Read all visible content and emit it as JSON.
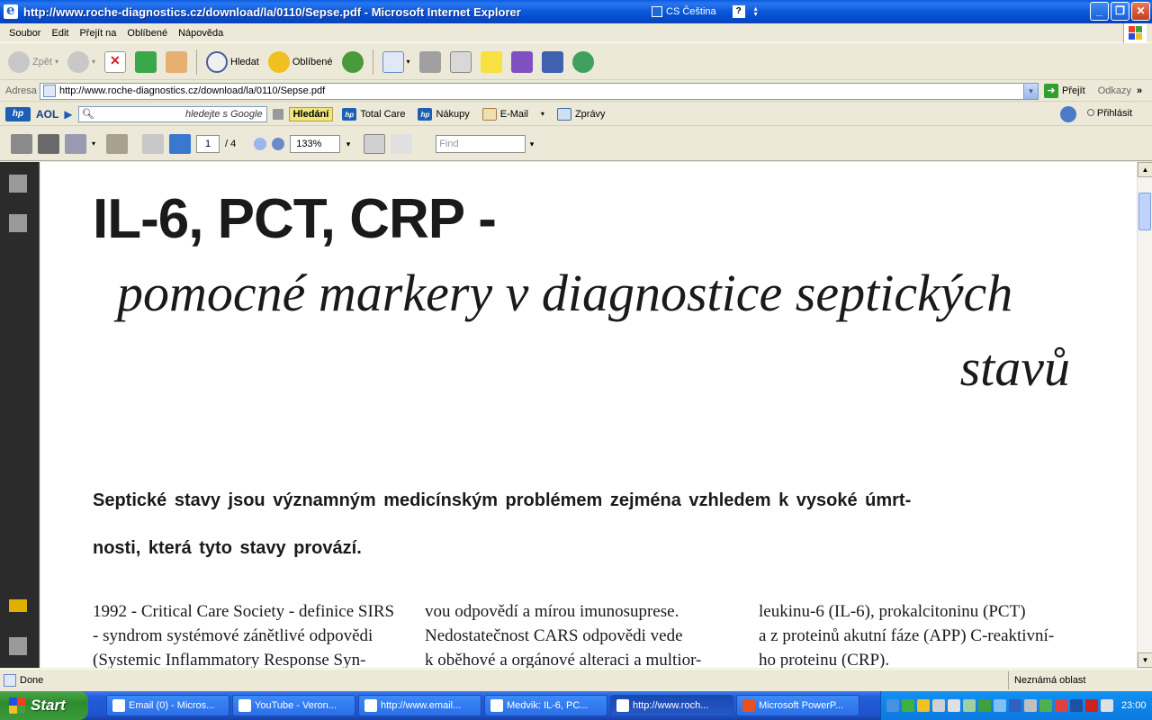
{
  "window": {
    "title": "http://www.roche-diagnostics.cz/download/la/0110/Sepse.pdf - Microsoft Internet Explorer",
    "language": "CS Čeština"
  },
  "menu": [
    "Soubor",
    "Edit",
    "Přejít na",
    "Oblíbené",
    "Nápověda"
  ],
  "toolbar": {
    "back_label": "Zpět",
    "search_label": "Hledat",
    "favorites_label": "Oblíbené"
  },
  "address": {
    "label": "Adresa",
    "url": "http://www.roche-diagnostics.cz/download/la/0110/Sepse.pdf",
    "go_label": "Přejít",
    "links_label": "Odkazy"
  },
  "hpbar": {
    "aol": "AOL",
    "search_hint": "hledejte s Google",
    "search_button": "Hledání",
    "total_care": "Total Care",
    "shopping": "Nákupy",
    "email": "E-Mail",
    "news": "Zprávy",
    "login": "Přihlásit"
  },
  "pdfbar": {
    "page": "1",
    "page_total": "/ 4",
    "zoom": "133%",
    "find_placeholder": "Find"
  },
  "document": {
    "title": "IL-6, PCT, CRP -",
    "subtitle_line1": "pomocné markery v diagnostice septických",
    "subtitle_line2": "stavů",
    "lead_line1": "Septické stavy jsou významným medicínským problémem zejména vzhledem k vysoké úmrt-",
    "lead_line2": "nosti, která tyto stavy provází.",
    "col1": [
      "1992 - Critical Care Society - definice SIRS",
      "- syndrom systémové zánětlivé odpovědi",
      "(Systemic Inflammatory Response Syn-"
    ],
    "col2": [
      "vou odpovědí a mírou imunosuprese.",
      "Nedostatečnost CARS odpovědi vede",
      "k oběhové a orgánové alteraci a multior-"
    ],
    "col3": [
      "leukinu-6 (IL-6), prokalcitoninu (PCT)",
      "a z proteinů akutní fáze (APP) C-reaktivní-",
      "ho proteinu (CRP)."
    ]
  },
  "status": {
    "text": "Done",
    "zone": "Neznámá oblast"
  },
  "taskbar": {
    "start": "Start",
    "tasks": [
      "Email (0) - Micros...",
      "YouTube - Veron...",
      "http://www.email...",
      "Medvik: IL-6, PC...",
      "http://www.roch...",
      "Microsoft PowerP..."
    ],
    "clock": "23:00"
  },
  "colors": {
    "titlebar": "#0a58d8",
    "chrome": "#ece9d8",
    "nav_pane": "#2b2b2b",
    "taskbar": "#245edb",
    "start_button": "#3a9a3a"
  }
}
